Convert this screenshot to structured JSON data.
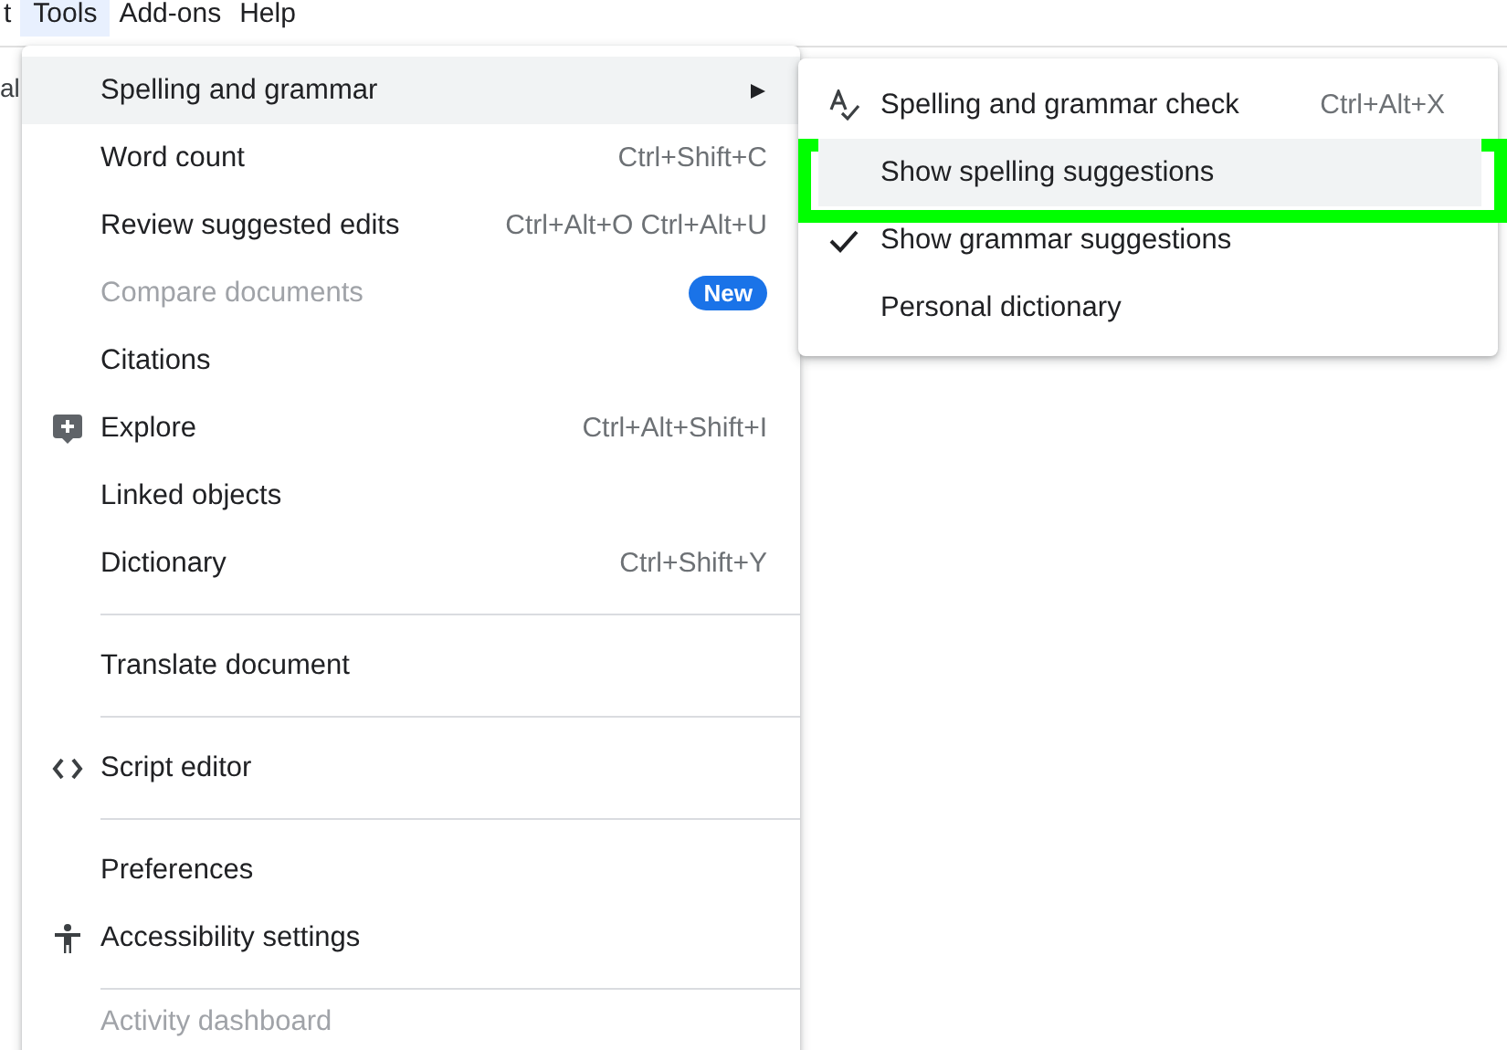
{
  "menubar": [
    {
      "label": "t",
      "selected": false
    },
    {
      "label": "Tools",
      "selected": true
    },
    {
      "label": "Add-ons",
      "selected": false
    },
    {
      "label": "Help",
      "selected": false
    }
  ],
  "toolbar_text": "al",
  "tools_menu": [
    {
      "kind": "item",
      "label": "Spelling and grammar",
      "submenu": true,
      "selected": true
    },
    {
      "kind": "item",
      "label": "Word count",
      "shortcut": "Ctrl+Shift+C",
      "selected": false
    },
    {
      "kind": "item",
      "label": "Review suggested edits",
      "shortcut": "Ctrl+Alt+O Ctrl+Alt+U",
      "selected": false
    },
    {
      "kind": "item",
      "label": "Compare documents",
      "badge": "New",
      "disabled": true,
      "selected": false
    },
    {
      "kind": "item",
      "label": "Citations",
      "selected": false
    },
    {
      "kind": "item",
      "label": "Explore",
      "shortcut": "Ctrl+Alt+Shift+I",
      "selected": false
    },
    {
      "kind": "item",
      "label": "Linked objects",
      "selected": false
    },
    {
      "kind": "item",
      "label": "Dictionary",
      "shortcut": "Ctrl+Shift+Y",
      "selected": false
    },
    {
      "kind": "divider"
    },
    {
      "kind": "item",
      "label": "Translate document",
      "selected": false
    },
    {
      "kind": "divider"
    },
    {
      "kind": "item",
      "label": "Script editor",
      "selected": false
    },
    {
      "kind": "divider"
    },
    {
      "kind": "item",
      "label": "Preferences",
      "selected": false
    },
    {
      "kind": "item",
      "label": "Accessibility settings",
      "selected": false
    },
    {
      "kind": "divider"
    },
    {
      "kind": "item",
      "label": "Activity dashboard",
      "disabled": true,
      "selected": false
    }
  ],
  "spelling_submenu": [
    {
      "label": "Spelling and grammar check",
      "shortcut": "Ctrl+Alt+X",
      "checked": false,
      "selected": false
    },
    {
      "label": "Show spelling suggestions",
      "checked": false,
      "selected": true,
      "annotated": true
    },
    {
      "label": "Show grammar suggestions",
      "checked": true,
      "selected": false
    },
    {
      "label": "Personal dictionary",
      "checked": false,
      "selected": false
    }
  ]
}
